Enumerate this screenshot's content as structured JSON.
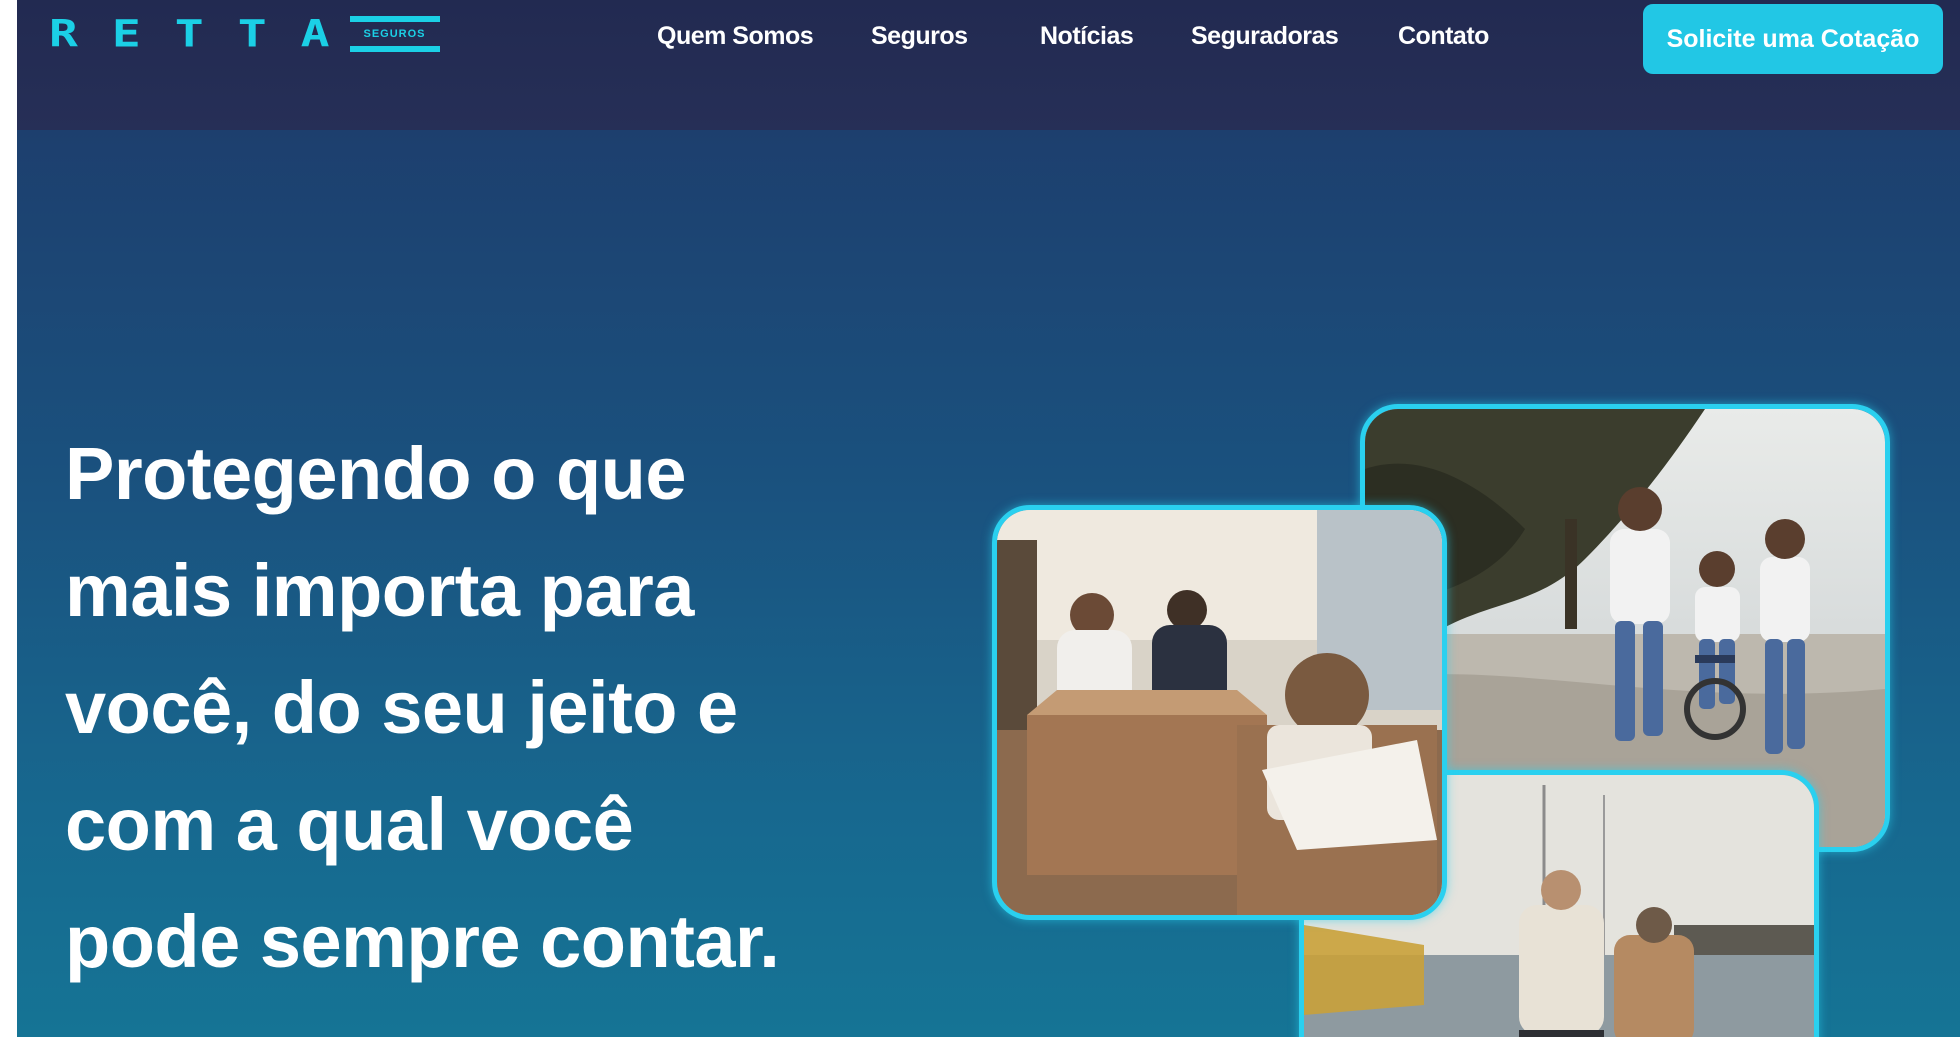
{
  "header": {
    "logo": {
      "text": "RETTA",
      "badge": "SEGUROS"
    },
    "nav": [
      {
        "label": "Quem Somos"
      },
      {
        "label": "Seguros"
      },
      {
        "label": "Notícias"
      },
      {
        "label": "Seguradoras"
      },
      {
        "label": "Contato"
      }
    ],
    "cta_label": "Solicite uma Cotação"
  },
  "hero": {
    "headline_lines": [
      "Protegendo o que",
      "mais importa para",
      "você, do seu jeito e",
      "com a qual você",
      "pode sempre contar."
    ],
    "images": [
      {
        "name": "family-walking-photo"
      },
      {
        "name": "seniors-boat-photo"
      },
      {
        "name": "family-moving-photo"
      }
    ]
  },
  "colors": {
    "header_bg": "#232b53",
    "accent": "#22c7e5",
    "hero_top": "#1d3f6e",
    "hero_bottom": "#157495",
    "text": "#ffffff"
  }
}
